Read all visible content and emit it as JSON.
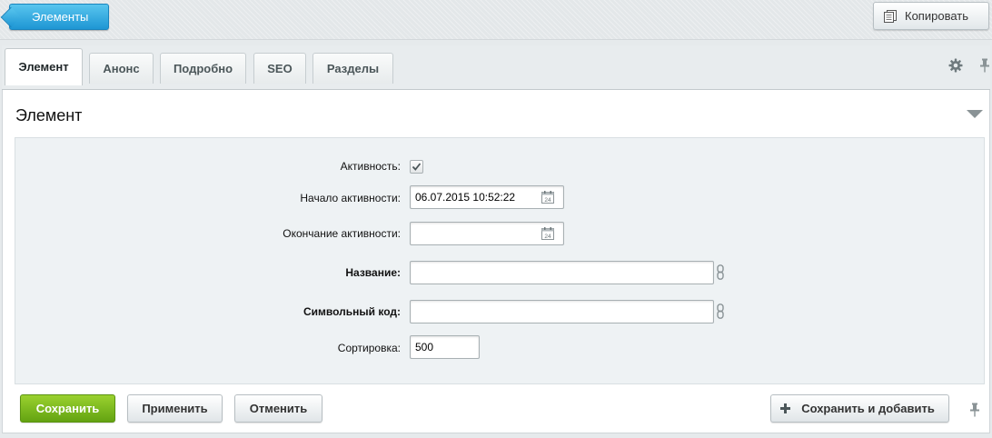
{
  "topbar": {
    "back_label": "Элементы",
    "copy_label": "Копировать",
    "copy_icon": "copy-icon"
  },
  "tabs": [
    {
      "label": "Элемент",
      "active": true
    },
    {
      "label": "Анонс",
      "active": false
    },
    {
      "label": "Подробно",
      "active": false
    },
    {
      "label": "SEO",
      "active": false
    },
    {
      "label": "Разделы",
      "active": false
    }
  ],
  "toolbar_icons": [
    "gear-icon",
    "pin-icon"
  ],
  "section": {
    "title": "Элемент",
    "collapse_icon": "triangle-down-icon"
  },
  "form": {
    "active": {
      "label": "Активность:",
      "checked": true
    },
    "start": {
      "label": "Начало активности:",
      "value": "06.07.2015 10:52:22",
      "icon_text": "24"
    },
    "end": {
      "label": "Окончание активности:",
      "value": "",
      "icon_text": "24"
    },
    "name": {
      "label": "Название:",
      "value": ""
    },
    "code": {
      "label": "Символьный код:",
      "value": ""
    },
    "sort": {
      "label": "Сортировка:",
      "value": "500"
    }
  },
  "footer": {
    "save_label": "Сохранить",
    "apply_label": "Применить",
    "cancel_label": "Отменить",
    "save_add_label": "Сохранить и добавить"
  },
  "colors": {
    "primary_blue": "#1e96d4",
    "save_green": "#63a312",
    "form_bg": "#eef2f4"
  }
}
